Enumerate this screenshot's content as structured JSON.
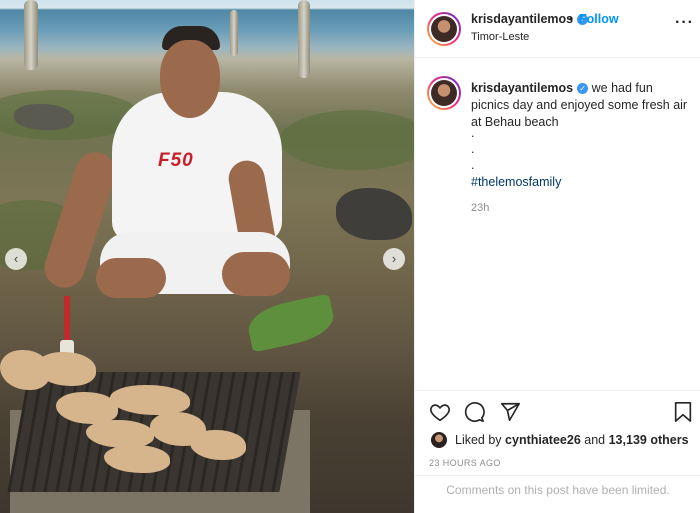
{
  "post": {
    "username": "krisdayantilemos",
    "follow_label": "Follow",
    "separator": "•",
    "location": "Timor-Leste",
    "more_icon": "more-options-icon",
    "caption_text": "we had fun picnics day and enjoyed some fresh air at Behau beach",
    "caption_dots": [
      ".",
      ".",
      "."
    ],
    "hashtag": "#thelemosfamily",
    "caption_time": "23h",
    "liked_by_prefix": "Liked by",
    "liked_by_user": "cynthiatee26",
    "liked_by_and": "and",
    "liked_by_count": "13,139 others",
    "post_time": "23 HOURS AGO",
    "comments_limited": "Comments on this post have been limited.",
    "photo_text": "F50"
  },
  "icons": {
    "like": "heart-icon",
    "comment": "comment-icon",
    "share": "share-icon",
    "save": "bookmark-icon",
    "prev": "chevron-left-icon",
    "next": "chevron-right-icon",
    "verified": "verified-badge-icon"
  },
  "colors": {
    "accent": "#0095f6",
    "verified": "#3897f0",
    "hashtag": "#00376b",
    "muted": "#8e8e8e"
  }
}
